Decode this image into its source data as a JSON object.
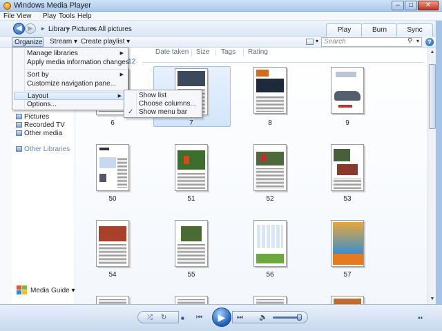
{
  "window": {
    "title": "Windows Media Player",
    "min": "–",
    "max": "□",
    "close": "✕"
  },
  "menubar": [
    "File",
    "View",
    "Play",
    "Tools",
    "Help"
  ],
  "nav": {
    "crumbs": [
      "Library",
      "Pictures",
      "All pictures"
    ],
    "sep": "▸",
    "tabs": [
      "Play",
      "Burn",
      "Sync"
    ]
  },
  "toolbar": {
    "organize": "Organize ▾",
    "stream": "Stream ▾",
    "create_playlist": "Create playlist ▾",
    "search_placeholder": "Search",
    "search_glass": "⚲",
    "dropdown": "▾",
    "help": "?"
  },
  "columns": [
    "Date taken",
    "Size",
    "Tags",
    "Rating"
  ],
  "group_label": "2012",
  "leftpane": {
    "items": [
      "Pictures",
      "Recorded TV",
      "Other media"
    ],
    "other_libraries": "Other Libraries",
    "media_guide": "Media Guide ▾"
  },
  "organize_menu": {
    "items": [
      "Manage libraries",
      "Apply media information changes",
      "Sort by",
      "Customize navigation pane...",
      "Layout",
      "Options..."
    ],
    "submenu_arrow": "▶"
  },
  "layout_submenu": {
    "items": [
      "Show list",
      "Choose columns...",
      "Show menu bar"
    ],
    "checkmark": "✓",
    "checked_item": "Show menu bar"
  },
  "thumbnails": [
    {
      "label": "6"
    },
    {
      "label": "7"
    },
    {
      "label": "8"
    },
    {
      "label": "9"
    },
    {
      "label": "50"
    },
    {
      "label": "51"
    },
    {
      "label": "52"
    },
    {
      "label": "53"
    },
    {
      "label": "54"
    },
    {
      "label": "55"
    },
    {
      "label": "56"
    },
    {
      "label": "57"
    }
  ],
  "player": {
    "shuffle": "⤮",
    "repeat": "↻",
    "stop": "■",
    "prev": "⏮",
    "play": "▶",
    "next": "⏭",
    "volume": "🔈",
    "switch_view": "▪▪"
  },
  "colors": {
    "accent": "#1e5fb5",
    "selection": "#d3e5fb",
    "close": "#c1321b"
  }
}
